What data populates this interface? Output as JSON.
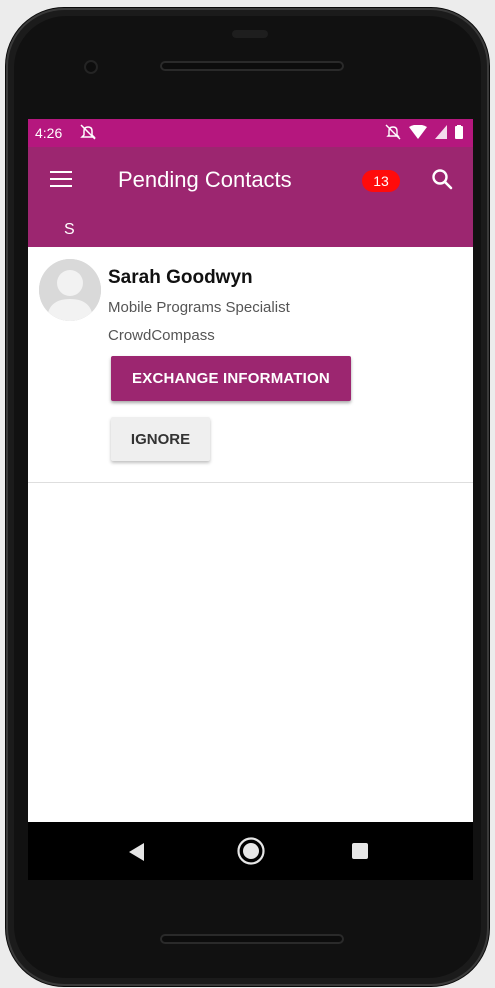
{
  "status": {
    "time": "4:26"
  },
  "appbar": {
    "title": "Pending Contacts",
    "badge_count": "13",
    "section_letter": "S"
  },
  "contact": {
    "name": "Sarah Goodwyn",
    "role": "Mobile Programs Specialist",
    "company": "CrowdCompass",
    "primary_action": "EXCHANGE INFORMATION",
    "secondary_action": "IGNORE"
  },
  "colors": {
    "status_bar": "#b5177e",
    "app_bar": "#9c2670",
    "badge": "#ff0b0b"
  },
  "icons": {
    "menu": "hamburger-menu-icon",
    "search": "search-icon",
    "back": "back-triangle-icon",
    "home": "home-circle-icon",
    "recent": "recent-apps-square-icon"
  }
}
